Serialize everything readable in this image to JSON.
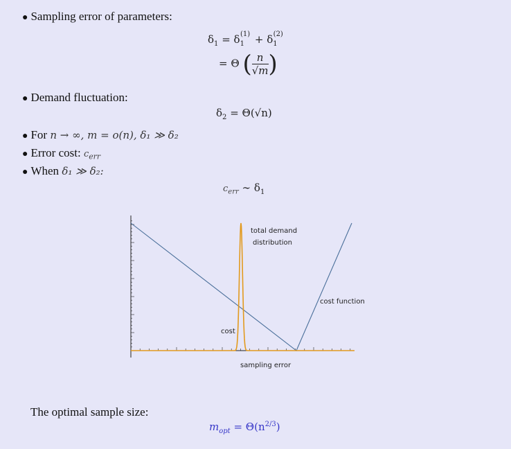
{
  "bullets": {
    "sampling_error": "Sampling error of parameters:",
    "demand_fluctuation": "Demand fluctuation:",
    "for_n": "For",
    "error_cost": "Error cost:",
    "when": "When"
  },
  "equations": {
    "delta1_line1_lhs": "δ",
    "delta1_eq": "=",
    "delta2_rhs": "= Θ(√n)",
    "theta": "Θ",
    "n": "n",
    "m": "m",
    "cerr_text": "c",
    "err_sub": "err",
    "approx": "∼",
    "for_cond": "n → ∞, m = o(n), δ₁ ≫ δ₂",
    "when_cond": "δ₁ ≫ δ₂:",
    "opt_lhs": "m",
    "opt_sub": "opt",
    "opt_rhs": "= Θ(n",
    "opt_exp": "2/3",
    "opt_close": ")"
  },
  "bottom_text": "The optimal sample size:",
  "chart_data": {
    "type": "line",
    "xlabel": "sampling error",
    "annotations": [
      "total demand",
      "distribution",
      "cost function",
      "cost"
    ],
    "series": [
      {
        "name": "cost function",
        "color": "#4a6f9a"
      },
      {
        "name": "total demand distribution",
        "color": "#e29a1e"
      }
    ],
    "grid": false
  },
  "colors": {
    "background": "#e6e6f8",
    "cost_line": "#4a6f9a",
    "demand_line": "#e29a1e",
    "accent_math": "#3737c8"
  }
}
